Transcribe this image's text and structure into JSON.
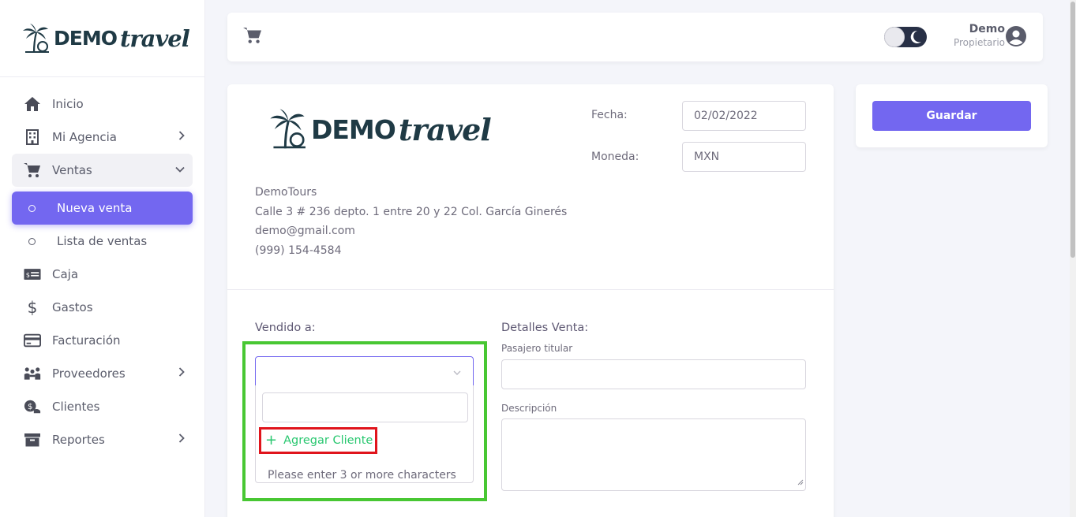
{
  "brand": {
    "demo": "DEMO",
    "travel": "travel"
  },
  "sidebar": {
    "items": [
      {
        "label": "Inicio",
        "icon": "home-icon"
      },
      {
        "label": "Mi Agencia",
        "icon": "building-icon"
      },
      {
        "label": "Ventas",
        "icon": "cart-icon"
      },
      {
        "label": "Nueva venta",
        "icon": "circle-icon"
      },
      {
        "label": "Lista de ventas",
        "icon": "circle-icon"
      },
      {
        "label": "Caja",
        "icon": "cash-icon"
      },
      {
        "label": "Gastos",
        "icon": "dollar-icon"
      },
      {
        "label": "Facturación",
        "icon": "credit-card-icon"
      },
      {
        "label": "Proveedores",
        "icon": "people-icon"
      },
      {
        "label": "Clientes",
        "icon": "clients-icon"
      },
      {
        "label": "Reportes",
        "icon": "archive-icon"
      }
    ]
  },
  "header": {
    "user_name": "Demo",
    "user_role": "Propietario"
  },
  "invoice": {
    "fecha_label": "Fecha:",
    "fecha_value": "02/02/2022",
    "moneda_label": "Moneda:",
    "moneda_value": "MXN",
    "company": {
      "name": "DemoTours",
      "address": "Calle 3 # 236 depto. 1 entre 20 y 22 Col. García Ginerés",
      "email": "demo@gmail.com",
      "phone": "(999) 154-4584"
    },
    "vendido_label": "Vendido a:",
    "detalles_label": "Detalles Venta:",
    "pasajero_label": "Pasajero titular",
    "descripcion_label": "Descripción",
    "add_client_label": "Agregar Cliente",
    "search_hint": "Please enter 3 or more characters"
  },
  "actions": {
    "save_label": "Guardar"
  },
  "colors": {
    "accent": "#7367f0",
    "success": "#28c76f",
    "highlight_green": "#48c733",
    "highlight_red": "#e0141c"
  }
}
